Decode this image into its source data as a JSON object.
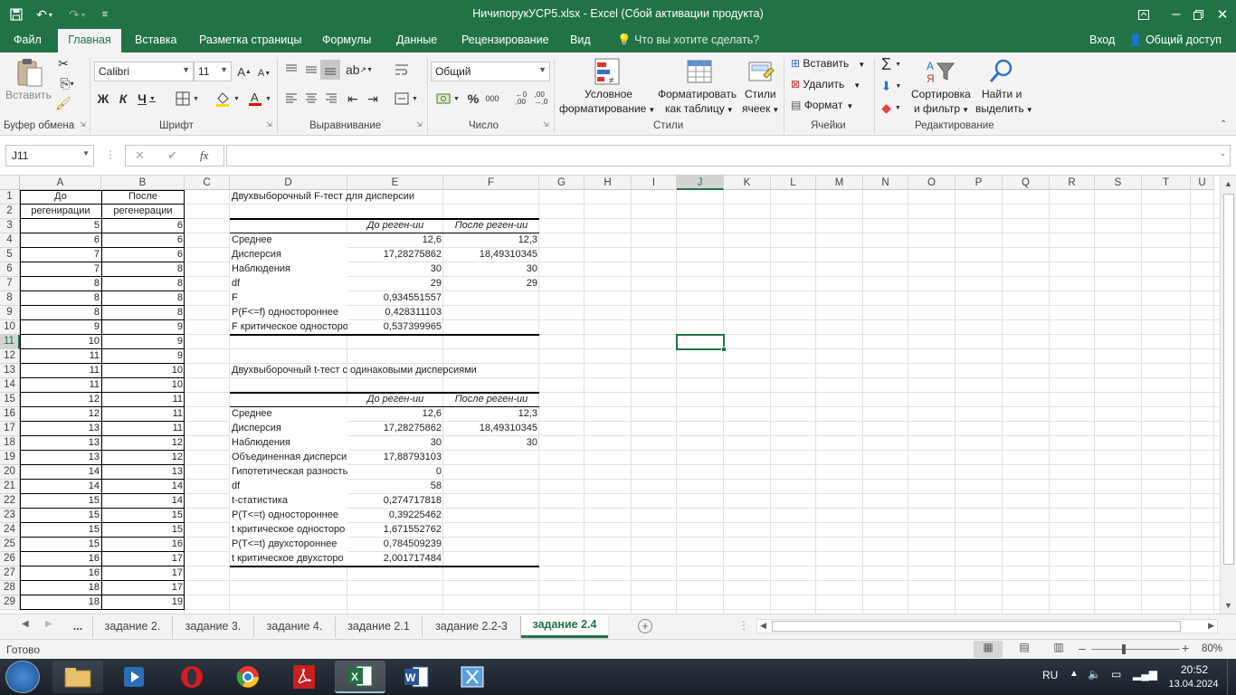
{
  "window": {
    "title": "НичипорукУСР5.xlsx - Excel (Сбой активации продукта)"
  },
  "tabs": [
    "Файл",
    "Главная",
    "Вставка",
    "Разметка страницы",
    "Формулы",
    "Данные",
    "Рецензирование",
    "Вид"
  ],
  "tell_me": "Что вы хотите сделать?",
  "signin": "Вход",
  "share": "Общий доступ",
  "ribbon": {
    "paste": "Вставить",
    "clipboard": "Буфер обмена",
    "font_name": "Calibri",
    "font_size": "11",
    "font": "Шрифт",
    "alignment": "Выравнивание",
    "number_format": "Общий",
    "number": "Число",
    "cond_fmt_1": "Условное",
    "cond_fmt_2": "форматирование",
    "fmt_table_1": "Форматировать",
    "fmt_table_2": "как таблицу",
    "cell_styles_1": "Стили",
    "cell_styles_2": "ячеек",
    "styles": "Стили",
    "insert": "Вставить",
    "delete": "Удалить",
    "format": "Формат",
    "cells": "Ячейки",
    "sort_1": "Сортировка",
    "sort_2": "и фильтр",
    "find_1": "Найти и",
    "find_2": "выделить",
    "editing": "Редактирование"
  },
  "formula_bar": {
    "name_box": "J11",
    "fx": "fx",
    "value": ""
  },
  "columns": [
    "A",
    "B",
    "C",
    "D",
    "E",
    "F",
    "G",
    "H",
    "I",
    "J",
    "K",
    "L",
    "M",
    "N",
    "O",
    "P",
    "Q",
    "R",
    "S",
    "T",
    "U"
  ],
  "rows": [
    "1",
    "2",
    "3",
    "4",
    "5",
    "6",
    "7",
    "8",
    "9",
    "10",
    "11",
    "12",
    "13",
    "14",
    "15",
    "16",
    "17",
    "18",
    "19",
    "20",
    "21",
    "22",
    "23",
    "24",
    "25",
    "26",
    "27",
    "28",
    "29"
  ],
  "col_a_header": [
    "До",
    "регенирации"
  ],
  "col_b_header": [
    "После",
    "регенерации"
  ],
  "col_a": [
    "5",
    "6",
    "7",
    "7",
    "8",
    "8",
    "8",
    "9",
    "10",
    "11",
    "11",
    "11",
    "12",
    "12",
    "13",
    "13",
    "13",
    "14",
    "14",
    "15",
    "15",
    "15",
    "15",
    "16",
    "16",
    "18",
    "18"
  ],
  "col_b": [
    "6",
    "6",
    "6",
    "8",
    "8",
    "8",
    "8",
    "9",
    "9",
    "9",
    "10",
    "10",
    "11",
    "11",
    "11",
    "12",
    "12",
    "13",
    "14",
    "14",
    "15",
    "15",
    "16",
    "17",
    "17",
    "17",
    "19"
  ],
  "ftest": {
    "title": "Двухвыборочный F-тест для дисперсии",
    "h1": "До реген-ии",
    "h2": "После реген-ии",
    "labels": [
      "Среднее",
      "Дисперсия",
      "Наблюдения",
      "df",
      "F",
      "P(F<=f) одностороннее",
      "F критическое односторо"
    ],
    "e": [
      "12,6",
      "17,28275862",
      "30",
      "29",
      "0,934551557",
      "0,428311103",
      "0,537399965"
    ],
    "f": [
      "12,3",
      "18,49310345",
      "30",
      "29",
      "",
      "",
      ""
    ]
  },
  "ttest": {
    "title": "Двухвыборочный t-тест с одинаковыми дисперсиями",
    "h1": "До реген-ии",
    "h2": "После реген-ии",
    "labels": [
      "Среднее",
      "Дисперсия",
      "Наблюдения",
      "Объединенная дисперсия",
      "Гипотетическая разность",
      "df",
      "t-статистика",
      "P(T<=t) одностороннее",
      "t критическое односторо",
      "P(T<=t) двухстороннее",
      "t критическое двухсторо"
    ],
    "e": [
      "12,6",
      "17,28275862",
      "30",
      "17,88793103",
      "0",
      "58",
      "0,274717818",
      "0,39225462",
      "1,671552762",
      "0,784509239",
      "2,001717484"
    ],
    "f": [
      "12,3",
      "18,49310345",
      "30",
      "",
      "",
      "",
      "",
      "",
      "",
      "",
      ""
    ]
  },
  "sheets": [
    "...",
    "задание 2.",
    "задание 3.",
    "задание 4.",
    "задание 2.1",
    "задание 2.2-3",
    "задание 2.4"
  ],
  "status": {
    "ready": "Готово",
    "zoom": "80%"
  },
  "taskbar": {
    "lang": "RU",
    "time": "20:52",
    "date": "13.04.2024"
  },
  "colors": {
    "excel_green": "#217346",
    "selection": "#217346"
  }
}
